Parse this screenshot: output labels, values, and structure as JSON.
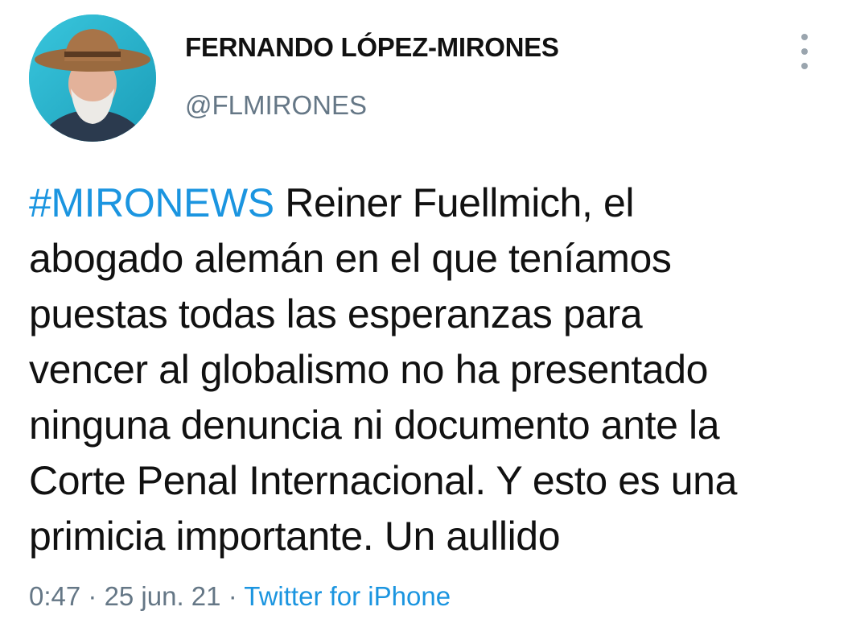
{
  "author": {
    "display_name": "FERNANDO LÓPEZ-MIRONES",
    "handle": "@FLMIRONES"
  },
  "tweet": {
    "hashtag": "#MIRONEWS",
    "lines": [
      " Reiner Fuellmich, el",
      "abogado alemán en el que teníamos",
      "puestas todas las esperanzas para",
      "vencer al globalismo no ha presentado",
      "ninguna denuncia ni documento ante la",
      "Corte Penal Internacional. Y esto es una",
      "primicia importante. Un aullido"
    ]
  },
  "meta": {
    "time": "0:47",
    "separator": " · ",
    "date": "25 jun. 21",
    "source": "Twitter for iPhone"
  },
  "icons": {
    "more": "more-vertical-icon",
    "avatar": "profile-photo"
  },
  "colors": {
    "accent": "#1b95e0",
    "secondary_text": "#657786",
    "primary_text": "#111111"
  }
}
